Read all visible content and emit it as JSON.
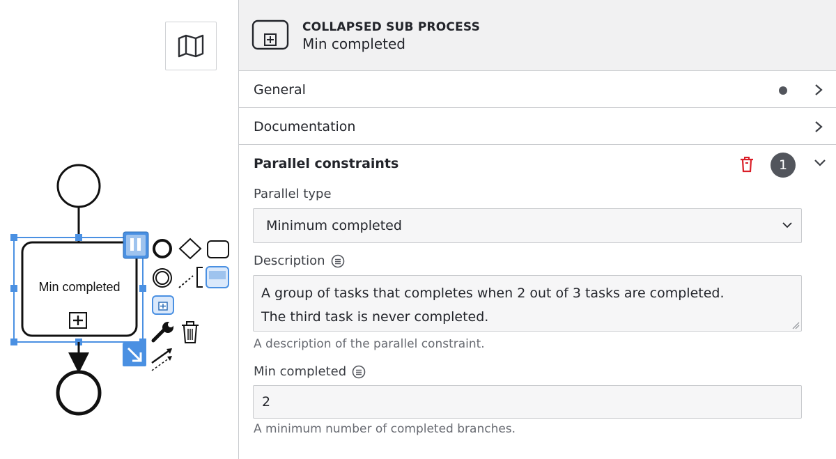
{
  "canvas": {
    "task_label": "Min completed",
    "map_button_icon": "map-icon",
    "selection_color": "#4a90e2",
    "palette_icons": [
      "start-event-icon",
      "gateway-icon",
      "task-icon",
      "intermediate-event-icon",
      "text-annotation-icon",
      "sub-process-icon",
      "collapsed-sub-process-icon",
      "wrench-icon",
      "trash-icon",
      "connect-arrow-icon"
    ]
  },
  "panel": {
    "header": {
      "type": "COLLAPSED SUB PROCESS",
      "name": "Min completed",
      "icon": "collapsed-sub-process-icon"
    },
    "groups": {
      "general": {
        "title": "General",
        "has_dot": true
      },
      "documentation": {
        "title": "Documentation"
      },
      "parallel": {
        "title": "Parallel constraints",
        "count": "1",
        "delete_color": "#da1e28",
        "fields": {
          "parallel_type": {
            "label": "Parallel type",
            "value": "Minimum completed"
          },
          "description": {
            "label": "Description",
            "value": "A group of tasks that completes when 2 out of 3 tasks are completed.\nThe third task is never completed.",
            "hint": "A description of the parallel constraint."
          },
          "min_completed": {
            "label": "Min completed",
            "value": "2",
            "hint": "A minimum number of completed branches."
          }
        }
      }
    }
  }
}
